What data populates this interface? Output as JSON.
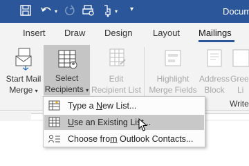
{
  "window": {
    "title": "Docum"
  },
  "tabs": [
    {
      "label": "Insert"
    },
    {
      "label": "Draw"
    },
    {
      "label": "Design"
    },
    {
      "label": "Layout"
    },
    {
      "label": "Mailings",
      "active": true
    }
  ],
  "ribbon": {
    "start_mail_merge": {
      "line1": "Start Mail",
      "line2": "Merge"
    },
    "select_recipients": {
      "line1": "Select",
      "line2": "Recipients"
    },
    "edit_recipient_list": {
      "line1": "Edit",
      "line2": "Recipient List"
    },
    "highlight_merge_fields": {
      "line1": "Highlight",
      "line2": "Merge Fields"
    },
    "address_block": {
      "line1": "Address",
      "line2": "Block"
    },
    "greeting_line": {
      "line1": "Gree",
      "line2": "Li"
    },
    "group_label": "Write"
  },
  "menu": {
    "items": [
      {
        "label_pre": "Type a ",
        "label_key": "N",
        "label_post": "ew List...",
        "icon": "new-list-icon"
      },
      {
        "label_pre": "",
        "label_key": "U",
        "label_post": "se an Existing List...",
        "icon": "existing-list-icon",
        "highlighted": true
      },
      {
        "label_pre": "Choose fro",
        "label_key": "m",
        "label_post": " Outlook Contacts...",
        "icon": "contacts-icon"
      }
    ]
  },
  "colors": {
    "title_bar": "#2b579a",
    "ribbon_bg": "#f3f3f3",
    "pressed_button": "#c5c5c5",
    "menu_hover": "#c8c8c8"
  }
}
